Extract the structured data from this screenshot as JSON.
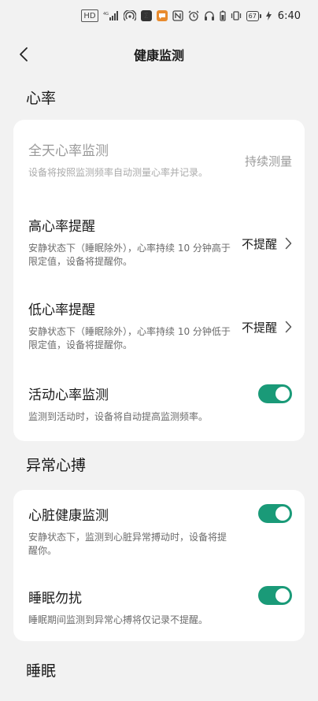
{
  "status_bar": {
    "hd_label": "HD",
    "signal_label": "4G",
    "battery_level": "67",
    "time": "6:40"
  },
  "header": {
    "title": "健康监测",
    "back_icon": "chevron-left-icon"
  },
  "sections": {
    "heart_rate": {
      "title": "心率",
      "rows": [
        {
          "title": "全天心率监测",
          "desc": "设备将按照监测频率自动测量心率并记录。",
          "value": "持续测量"
        },
        {
          "title": "高心率提醒",
          "desc": "安静状态下（睡眠除外），心率持续 10 分钟高于限定值，设备将提醒你。",
          "value": "不提醒"
        },
        {
          "title": "低心率提醒",
          "desc": "安静状态下（睡眠除外），心率持续 10 分钟低于限定值，设备将提醒你。",
          "value": "不提醒"
        },
        {
          "title": "活动心率监测",
          "desc": "监测到活动时，设备将自动提高监测频率。"
        }
      ]
    },
    "abnormal": {
      "title": "异常心搏",
      "rows": [
        {
          "title": "心脏健康监测",
          "desc": "安静状态下，监测到心脏异常搏动时，设备将提醒你。"
        },
        {
          "title": "睡眠勿扰",
          "desc": "睡眠期间监测到异常心搏将仅记录不提醒。"
        }
      ]
    },
    "sleep": {
      "title": "睡眠"
    }
  },
  "colors": {
    "toggle_on": "#1a9a78",
    "background": "#f2f2f2",
    "card": "#ffffff"
  }
}
